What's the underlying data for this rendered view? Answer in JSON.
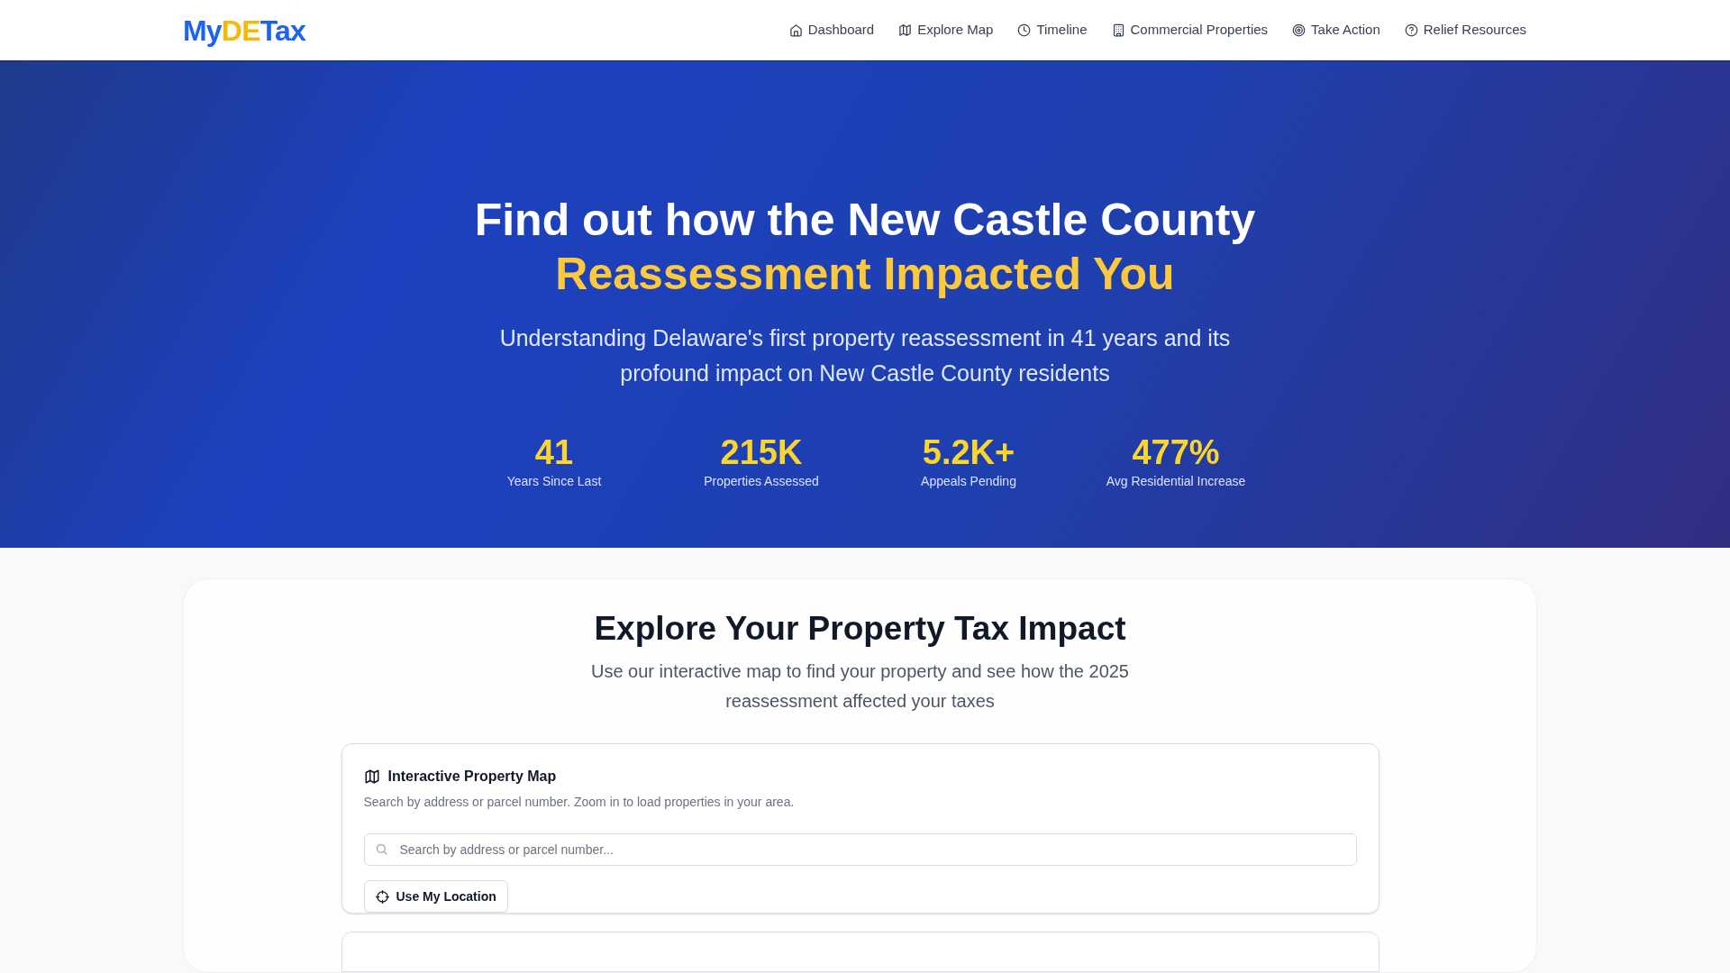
{
  "logo": {
    "parts": [
      {
        "text": "My",
        "color": "#1d63f0"
      },
      {
        "text": "DE",
        "color": "#f5b80b"
      },
      {
        "text": "Tax",
        "color": "#1d63f0"
      }
    ]
  },
  "nav": [
    {
      "label": "Dashboard"
    },
    {
      "label": "Explore Map"
    },
    {
      "label": "Timeline"
    },
    {
      "label": "Commercial Properties"
    },
    {
      "label": "Take Action"
    },
    {
      "label": "Relief Resources"
    }
  ],
  "hero": {
    "title": "Find out how the New Castle County",
    "title_highlight": "Reassessment Impacted You",
    "subtitle": "Understanding Delaware's first property reassessment in 41 years and its profound impact on New Castle County residents",
    "stats": [
      {
        "value": "41",
        "label": "Years Since Last"
      },
      {
        "value": "215K",
        "label": "Properties Assessed"
      },
      {
        "value": "5.2K+",
        "label": "Appeals Pending"
      },
      {
        "value": "477%",
        "label": "Avg Residential Increase"
      }
    ]
  },
  "explore": {
    "title": "Explore Your Property Tax Impact",
    "subtitle": "Use our interactive map to find your property and see how the 2025 reassessment affected your taxes",
    "map_card": {
      "title": "Interactive Property Map",
      "description": "Search by address or parcel number. Zoom in to load properties in your area.",
      "search": {
        "placeholder": "Search by address or parcel number..."
      },
      "button": "Use My Location"
    }
  }
}
